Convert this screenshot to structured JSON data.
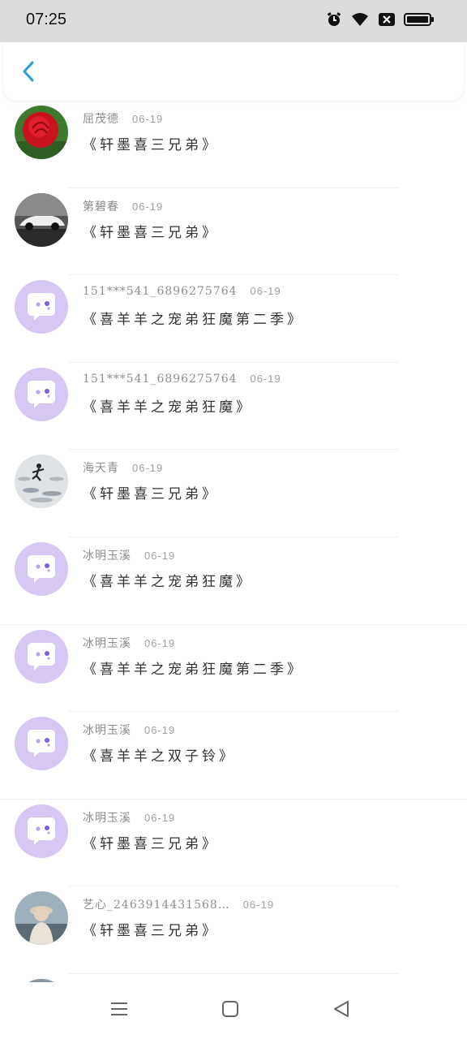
{
  "status": {
    "time": "07:25"
  },
  "header": {
    "back_icon": "chevron-left-icon"
  },
  "items": [
    {
      "user": "屈茂德",
      "date": "06-19",
      "title": "《轩墨喜三兄弟》",
      "avatar": "rose-photo"
    },
    {
      "user": "第碧春",
      "date": "06-19",
      "title": "《轩墨喜三兄弟》",
      "avatar": "car-photo"
    },
    {
      "user": "151***541_6896275764",
      "date": "06-19",
      "title": "《喜羊羊之宠弟狂魔第二季》",
      "avatar": "default-chat-avatar"
    },
    {
      "user": "151***541_6896275764",
      "date": "06-19",
      "title": "《喜羊羊之宠弟狂魔》",
      "avatar": "default-chat-avatar"
    },
    {
      "user": "海天青",
      "date": "06-19",
      "title": "《轩墨喜三兄弟》",
      "avatar": "runner-photo"
    },
    {
      "user": "冰明玉溪",
      "date": "06-19",
      "title": "《喜羊羊之宠弟狂魔》",
      "avatar": "default-chat-avatar"
    },
    {
      "user": "冰明玉溪",
      "date": "06-19",
      "title": "《喜羊羊之宠弟狂魔第二季》",
      "avatar": "default-chat-avatar"
    },
    {
      "user": "冰明玉溪",
      "date": "06-19",
      "title": "《喜羊羊之双子铃》",
      "avatar": "default-chat-avatar"
    },
    {
      "user": "冰明玉溪",
      "date": "06-19",
      "title": "《轩墨喜三兄弟》",
      "avatar": "default-chat-avatar"
    },
    {
      "user": "艺心_2463914431568…",
      "date": "06-19",
      "title": "《轩墨喜三兄弟》",
      "avatar": "person-photo"
    }
  ],
  "colors": {
    "accent": "#2b9ad6",
    "default_avatar_bg": "#d6c7f5",
    "status_bar": "#dcdcdc"
  },
  "system_nav": [
    "menu-icon",
    "home-icon",
    "back-triangle-icon"
  ]
}
